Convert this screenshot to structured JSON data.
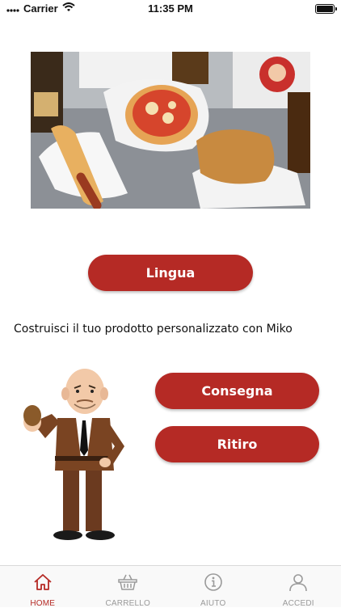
{
  "status_bar": {
    "carrier": "Carrier",
    "time": "11:35 PM"
  },
  "main": {
    "language_button": "Lingua",
    "tagline": "Costruisci il tuo prodotto personalizzato con Miko",
    "delivery_button": "Consegna",
    "pickup_button": "Ritiro"
  },
  "tab_bar": {
    "items": [
      {
        "label": "HOME",
        "icon": "home-icon",
        "active": true
      },
      {
        "label": "CARRELLO",
        "icon": "basket-icon",
        "active": false
      },
      {
        "label": "AIUTO",
        "icon": "info-icon",
        "active": false
      },
      {
        "label": "ACCEDI",
        "icon": "user-icon",
        "active": false
      }
    ],
    "active_color": "#b52a25",
    "inactive_color": "#9a9a9a"
  },
  "colors": {
    "accent": "#b52a25"
  }
}
